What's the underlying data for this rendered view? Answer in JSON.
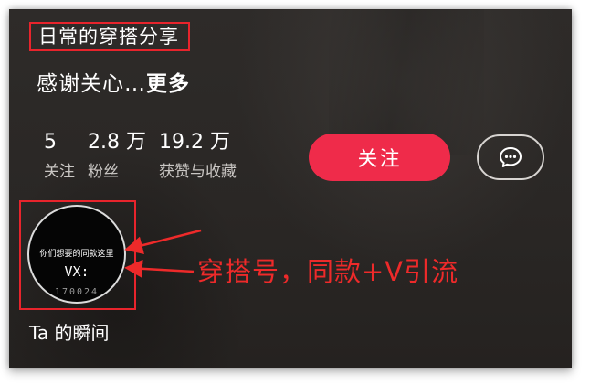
{
  "profile": {
    "title": "日常的穿搭分享",
    "description_prefix": "感谢关心…",
    "description_more": "更多",
    "stats": [
      {
        "value": "5",
        "label": "关注"
      },
      {
        "value": "2.8 万",
        "label": "粉丝"
      },
      {
        "value": "19.2 万",
        "label": "获赞与收藏"
      }
    ],
    "follow_label": "关注",
    "message_icon": "chat-bubble-icon"
  },
  "moments": {
    "thumb_line1": "你们想要的同款这里",
    "thumb_line2": "VX:",
    "thumb_line3": "170024",
    "label": "Ta 的瞬间"
  },
  "annotation": {
    "text": "穿搭号，同款+V引流",
    "color": "#ee2a2a"
  },
  "colors": {
    "background": "#2a2725",
    "follow_button": "#ef2b4a",
    "highlight_box": "#e8242c"
  }
}
